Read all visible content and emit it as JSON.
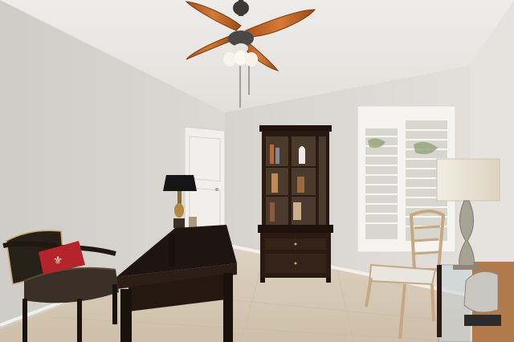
{
  "scene": {
    "kind": "interior-photo",
    "palette": {
      "wall_left": "#d8d5d1",
      "wall_back": "#dedbd7",
      "ceiling": "#ebe9e6",
      "floor": "#d9cdbb",
      "wood_dark": "#2a1a12",
      "fan_blade": "#c86a2a",
      "window_frame": "#f4f3f0",
      "pillow": "#b3242b"
    }
  }
}
